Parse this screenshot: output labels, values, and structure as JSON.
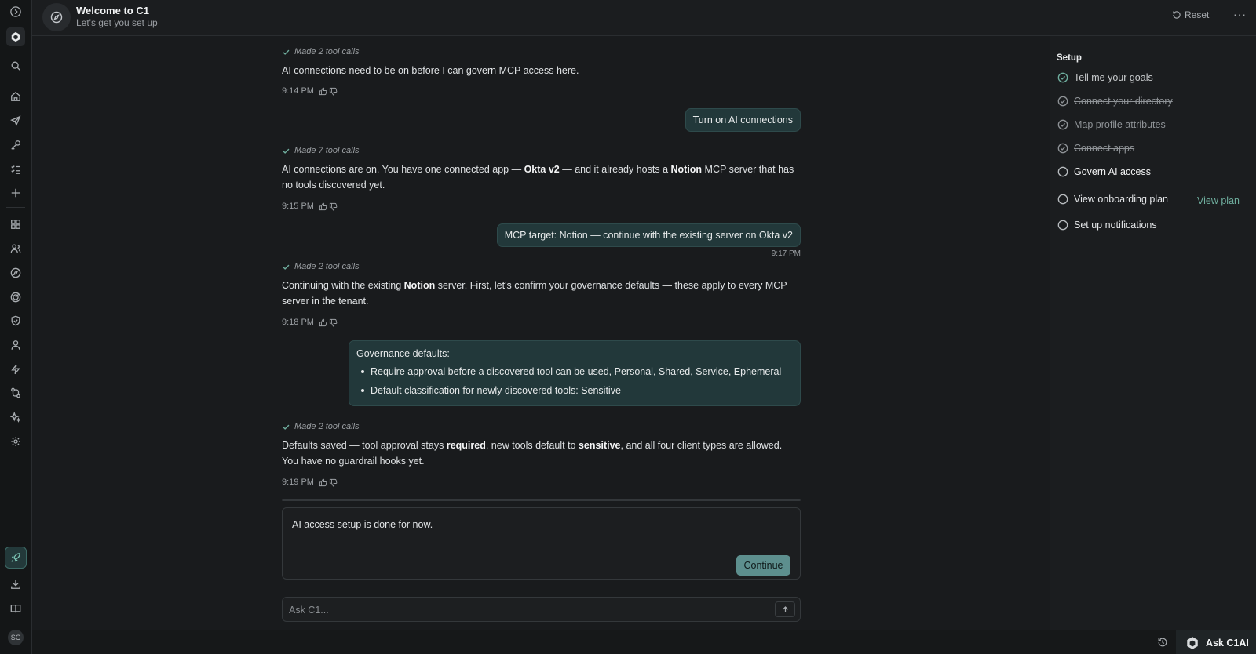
{
  "header": {
    "title": "Welcome to C1",
    "subtitle": "Let's get you set up",
    "reset_label": "Reset",
    "more_label": "···"
  },
  "rail": {
    "avatar_initials": "SC"
  },
  "chat": {
    "blocks": [
      {
        "tool_calls": "Made 2 tool calls",
        "text": "AI connections need to be on before I can govern MCP access here.",
        "time": "9:14 PM"
      },
      {
        "user": "Turn on AI connections"
      },
      {
        "tool_calls": "Made 7 tool calls",
        "text_parts": [
          "AI connections are on. You have one connected app — ",
          "Okta v2",
          " — and it already hosts a ",
          "Notion",
          " MCP server that has no tools discovered yet."
        ],
        "time": "9:15 PM"
      },
      {
        "user": "MCP target: Notion — continue with the existing server on Okta v2",
        "user_time": "9:17 PM"
      },
      {
        "tool_calls": "Made 2 tool calls",
        "text_parts": [
          "Continuing with the existing ",
          "Notion",
          " server. First, let's confirm your governance defaults — these apply to every MCP server in the tenant."
        ],
        "time": "9:18 PM"
      },
      {
        "tool_calls": "Made 2 tool calls",
        "text_parts": [
          "Defaults saved — tool approval stays ",
          "required",
          ", new tools default to ",
          "sensitive",
          ", and all four client types are allowed. You have no guardrail hooks yet."
        ],
        "time": "9:19 PM"
      }
    ],
    "governance": {
      "title": "Governance defaults:",
      "items": [
        "Require approval before a discovered tool can be used, Personal, Shared, Service, Ephemeral",
        "Default classification for newly discovered tools: Sensitive"
      ]
    },
    "panel": {
      "text": "AI access setup is done for now.",
      "continue_label": "Continue"
    },
    "input": {
      "placeholder": "Ask C1..."
    }
  },
  "setup": {
    "title": "Setup",
    "steps": [
      {
        "label": "Tell me your goals",
        "state": "done"
      },
      {
        "label": "Connect your directory",
        "state": "struck"
      },
      {
        "label": "Map profile attributes",
        "state": "struck"
      },
      {
        "label": "Connect apps",
        "state": "struck"
      },
      {
        "label": "Govern AI access",
        "state": "current"
      },
      {
        "label": "View onboarding plan",
        "state": "pending"
      },
      {
        "label": "Set up notifications",
        "state": "pending"
      }
    ],
    "view_plan_label": "View plan"
  },
  "footer": {
    "ask_ai_label": "Ask C1AI"
  },
  "colors": {
    "accent": "#5d8f8e",
    "bubble": "#22383a",
    "done_check": "#6fae9e"
  }
}
